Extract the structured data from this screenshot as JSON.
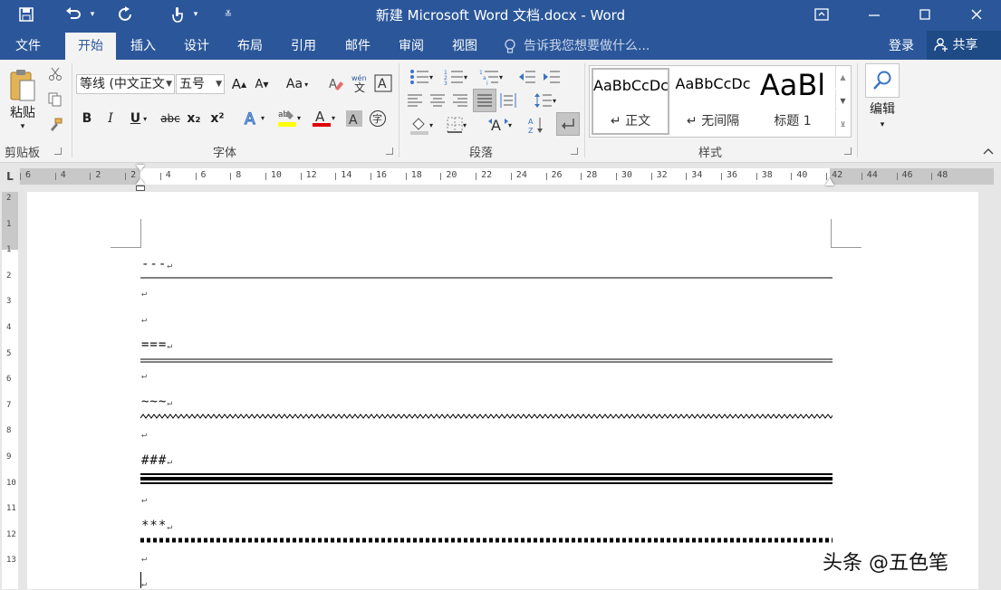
{
  "titlebar": {
    "title": "新建 Microsoft Word 文档.docx - Word",
    "save_icon": "save-icon",
    "undo_icon": "undo-icon",
    "redo_icon": "redo-icon",
    "touch_icon": "touch-mode-icon"
  },
  "tabs": [
    "文件",
    "开始",
    "插入",
    "设计",
    "布局",
    "引用",
    "邮件",
    "审阅",
    "视图"
  ],
  "active_tab": "开始",
  "tellme": "告诉我您想要做什么...",
  "account": {
    "login": "登录",
    "share": "共享"
  },
  "ribbon": {
    "clipboard": {
      "paste": "粘贴",
      "label": "剪贴板"
    },
    "font": {
      "name": "等线 (中文正文",
      "size": "五号",
      "change_case": "Aa",
      "bold": "B",
      "italic": "I",
      "underline": "U",
      "strike": "abc",
      "sub": "x₂",
      "sup": "x²",
      "label": "字体"
    },
    "paragraph": {
      "label": "段落"
    },
    "styles": {
      "items": [
        {
          "sample": "AaBbCcDc",
          "name": "↵ 正文"
        },
        {
          "sample": "AaBbCcDc",
          "name": "↵ 无间隔"
        },
        {
          "sample": "AaBl",
          "name": "标题 1"
        }
      ],
      "label": "样式"
    },
    "editing": {
      "label": "编辑"
    }
  },
  "ruler": {
    "h_marks": [
      "6",
      "4",
      "2",
      "2",
      "4",
      "6",
      "8",
      "10",
      "12",
      "14",
      "16",
      "18",
      "20",
      "22",
      "24",
      "26",
      "28",
      "30",
      "32",
      "34",
      "36",
      "38",
      "40",
      "42",
      "44",
      "46",
      "48"
    ],
    "v_marks": [
      "2",
      "1",
      "1",
      "2",
      "3",
      "4",
      "5",
      "6",
      "7",
      "8",
      "9",
      "10",
      "11",
      "12",
      "13"
    ]
  },
  "document": {
    "lines": [
      "---",
      "===",
      "~~~",
      "###",
      "***"
    ],
    "return_mark": "↵"
  },
  "watermark": "头条 @五色笔"
}
